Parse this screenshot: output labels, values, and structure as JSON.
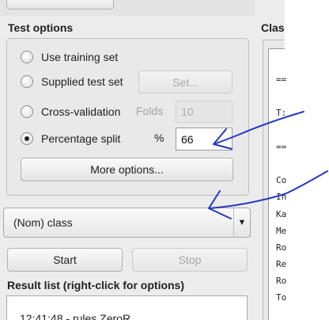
{
  "test_options": {
    "title": "Test options",
    "use_training_set": "Use training set",
    "supplied_test_set": "Supplied test set",
    "set_button": "Set...",
    "cross_validation": "Cross-validation",
    "folds_label": "Folds",
    "folds_value": "10",
    "percentage_split": "Percentage split",
    "percent_symbol": "%",
    "percentage_value": "66",
    "selected_option": "Percentage split",
    "more_options": "More options..."
  },
  "class_selector": {
    "value": "(Nom) class",
    "arrow_icon": "triangle-down-icon"
  },
  "actions": {
    "start": "Start",
    "stop": "Stop"
  },
  "result_list": {
    "title": "Result list (right-click for options)",
    "items": [
      "12:41:48 - rules.ZeroR"
    ]
  },
  "classifier_output": {
    "title_fragment": "Clas",
    "lines": [
      "==",
      "T:",
      "==",
      "Co",
      "In",
      "Ka",
      "Me",
      "Ro",
      "Re",
      "Ro",
      "To"
    ]
  },
  "annotation": {
    "color": "#2437c4"
  }
}
